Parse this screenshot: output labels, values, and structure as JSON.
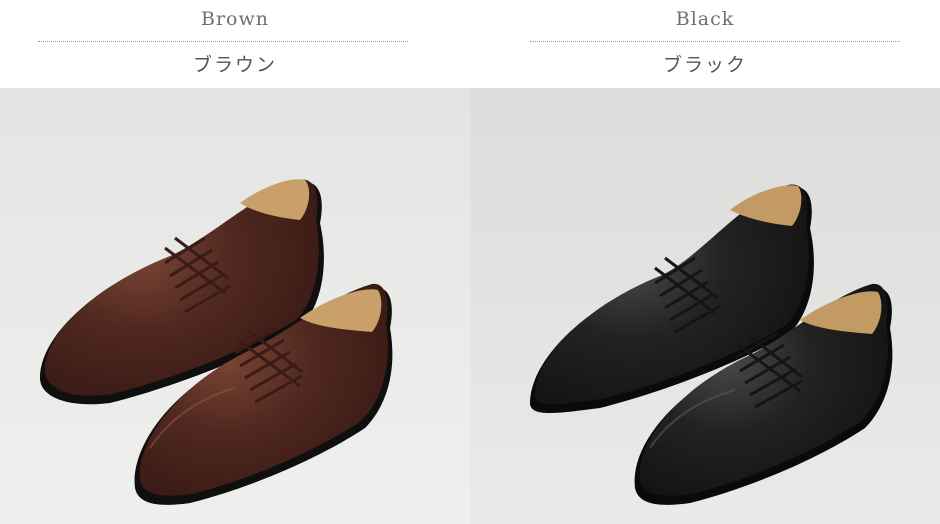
{
  "variants": [
    {
      "name_en": "Brown",
      "name_ja": "ブラウン",
      "image_icon": "brown-oxford-shoes-image",
      "colors": {
        "upper": "#4a241d",
        "upper_light": "#6b3a2d",
        "sole": "#111111",
        "lining": "#c9a06a",
        "lace": "#3a1c16"
      }
    },
    {
      "name_en": "Black",
      "name_ja": "ブラック",
      "image_icon": "black-oxford-shoes-image",
      "colors": {
        "upper": "#1b1b1b",
        "upper_light": "#3a3a3a",
        "sole": "#0a0a0a",
        "lining": "#c49a64",
        "lace": "#151515"
      }
    }
  ],
  "background": {
    "header": "#ffffff",
    "photo_left": "#e9e9e7",
    "photo_right": "#e3e3e1",
    "divider": "#9a9a9a"
  }
}
